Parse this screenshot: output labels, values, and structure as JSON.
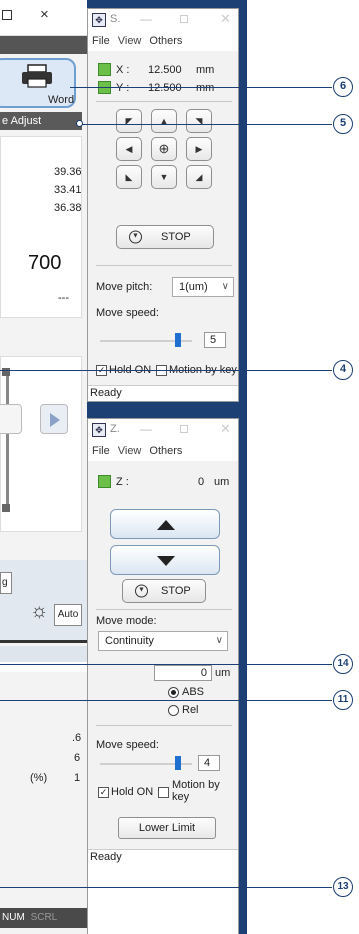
{
  "main_window": {
    "close_glyph": "×",
    "word_button_label": "Word",
    "adjust_button_label": "e Adjust",
    "values": [
      "39.36",
      "33.41",
      "36.38"
    ],
    "big_value": "700",
    "dashes": "---",
    "left_button_label": "g",
    "auto_button_label": "Auto",
    "readouts": [
      ".6",
      "6",
      "1"
    ],
    "percent_label": "(%)",
    "status": {
      "num": "NUM",
      "scrl": "SCRL"
    }
  },
  "xy_window": {
    "title": "S.",
    "menu": {
      "file": "File",
      "view": "View",
      "others": "Others"
    },
    "x_label": "X :",
    "x_value": "12.500",
    "x_unit": "mm",
    "y_label": "Y :",
    "y_value": "12.500",
    "y_unit": "mm",
    "stop_label": "STOP",
    "move_pitch_label": "Move pitch:",
    "move_pitch_value": "1(um)",
    "move_speed_label": "Move speed:",
    "move_speed_value": "5",
    "move_speed_level": 0.85,
    "hold_on_label": "Hold ON",
    "motion_by_key_label": "Motion by key",
    "status": "Ready"
  },
  "z_window": {
    "title": "Z.",
    "menu": {
      "file": "File",
      "view": "View",
      "others": "Others"
    },
    "z_label": "Z :",
    "z_value": "0",
    "z_unit": "um",
    "stop_label": "STOP",
    "move_mode_label": "Move mode:",
    "move_mode_value": "Continuity",
    "distance_value": "0",
    "distance_unit": "um",
    "abs_label": "ABS",
    "rel_label": "Rel",
    "move_speed_label": "Move speed:",
    "move_speed_value": "4",
    "move_speed_level": 0.85,
    "hold_on_label": "Hold ON",
    "motion_by_key_label": "Motion by key",
    "lower_limit_label": "Lower Limit",
    "status": "Ready"
  },
  "callouts": [
    "6",
    "5",
    "4",
    "14",
    "11",
    "13"
  ],
  "colors": {
    "blue_band": "#1c3f74",
    "status_green": "#6cc04a",
    "slider_blue": "#1f6fd0"
  }
}
